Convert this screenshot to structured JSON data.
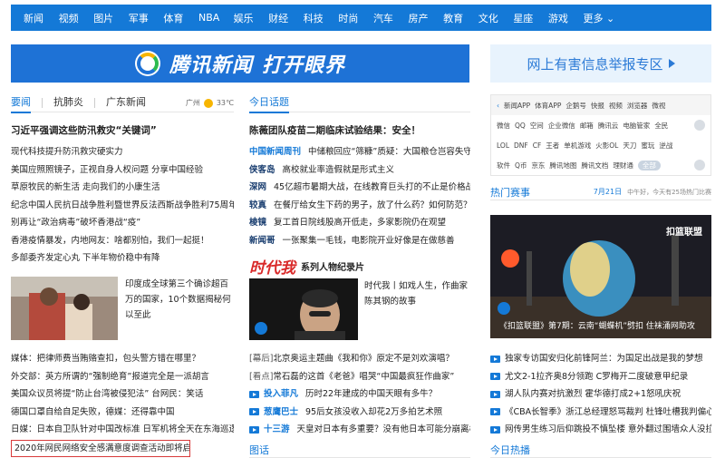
{
  "nav": [
    "新闻",
    "视频",
    "图片",
    "军事",
    "体育",
    "NBA",
    "娱乐",
    "财经",
    "科技",
    "时尚",
    "汽车",
    "房产",
    "教育",
    "文化",
    "星座",
    "游戏",
    "更多"
  ],
  "banner": {
    "brand": "腾讯新闻",
    "slogan": "打开眼界"
  },
  "report": {
    "label": "网上有害信息举报专区"
  },
  "left": {
    "tabs": [
      "要闻",
      "抗肺炎",
      "广东新闻"
    ],
    "weather": {
      "city": "广州",
      "temp": "33℃"
    },
    "headline": "习近平强调这些防汛救灾“关键词”",
    "items": [
      "现代科技提升防汛救灾硬实力",
      "美国应照照镜子，正视自身人权问题 分享中国经验",
      "草原牧民的新生活 走向我们的小康生活",
      "纪念中国人民抗日战争胜利暨世界反法西斯战争胜利75周年",
      "别再让“政治病毒”破坏香港战“疫”",
      "香港疫情暴发，内地网友：啥都别怕，我们一起挺！",
      "多部委齐发定心丸 下半年物价稳中有降"
    ],
    "feature": {
      "text": "印度成全球第三个确诊超百万的国家，10个数据揭秘何以至此"
    },
    "items2": [
      "媒体：把律师费当贿赂查扣，包头警方错在哪里？",
      "外交部：英方所谓的“强制绝育”报道完全是一派胡言",
      "美国众议员将提“防止台湾被侵犯法” 台网民：笑话",
      "德国口罩自给自足失败，德媒：还得靠中国",
      "日媒：日本自卫队针对中国改标准 日军机将全天在东海巡逻",
      "2020年网民网络安全感满意度调查活动即将启动"
    ]
  },
  "mid": {
    "tab": "今日话题",
    "headline": "陈薇团队疫苗二期临床试验结果：安全！",
    "tagged": [
      {
        "tag": "中国新闻周刊",
        "text": "中储粮回应“筛糠”质疑：大国粮仓岂容失守"
      },
      {
        "tag": "侠客岛",
        "text": "高校就业率造假就是形式主义"
      },
      {
        "tag": "深网",
        "text": "45亿超市暑期大战，在线教育巨头打的不止是价格战"
      },
      {
        "tag": "较真",
        "text": "在餐厅给女生下药的男子，放了什么药？如何防范？"
      },
      {
        "tag": "棱镜",
        "text": "复工首日院线股高开低走，多家影院仍在观望"
      },
      {
        "tag": "新闻哥",
        "text": "一张聚集一毛钱，电影院开业好像是在做慈善"
      }
    ],
    "series": {
      "logo": "时代我",
      "title": "系列人物纪录片",
      "desc": "时代我丨如戏人生，作曲家陈其钢的故事"
    },
    "items": [
      {
        "prefix": "[幕后]",
        "text": "北京奥运主题曲《我和你》原定不是刘欢演唱？",
        "tag": ""
      },
      {
        "prefix": "[看点]",
        "text": "常石磊的这首《老爸》唱哭“中国最疯狂作曲家”",
        "tag": ""
      },
      {
        "prefix": "",
        "text": "历时22年建成的中国天眼有多牛？",
        "tag": "投入菲凡"
      },
      {
        "prefix": "",
        "text": "95后女孩没收入却花2万多拍艺术照",
        "tag": "葱鹰巴士"
      },
      {
        "prefix": "",
        "text": "天皇对日本有多重要？没有他日本可能分崩离析",
        "tag": "十三游"
      }
    ],
    "footer": "图话"
  },
  "right": {
    "links": [
      [
        "新闻APP",
        "体育APP",
        "企鹅号",
        "快报",
        "视频",
        "浏览器",
        "微视"
      ],
      [
        "微信",
        "QQ",
        "空间",
        "企业微信",
        "邮箱",
        "腾讯云",
        "电脑管家",
        "全民"
      ],
      [
        "LOL",
        "DNF",
        "CF",
        "王者",
        "单机游戏",
        "火影OL",
        "天刀",
        "蜜玩",
        "逆战"
      ],
      [
        "软件",
        "Q币",
        "京东",
        "腾讯地图",
        "腾讯文档",
        "理财通",
        "全部"
      ]
    ],
    "hot": {
      "title": "热门赛事",
      "date": "7月21日",
      "note": "中午好，今天有25场热门比赛"
    },
    "video": {
      "caption": "《扣篮联盟》第7期：云南“蝴蝶机”劈扣 住袜涌网助攻",
      "badge": "扣篮联盟"
    },
    "items": [
      "独家专访国安归化前锋阿兰：为国足出战是我的梦想",
      "尤文2-1拉齐奥8分领跑 C罗梅开二度破意甲纪录",
      "湖人队内赛对抗激烈 霍华德打成2+1怒吼庆祝",
      "《CBA长智季》浙江总经理怒骂裁判 杜锋吐槽我判偏心",
      "网传男生练习后仰跳投不慎坠楼 意外翻过围墙众人没拉住"
    ],
    "footer": "今日热播"
  }
}
